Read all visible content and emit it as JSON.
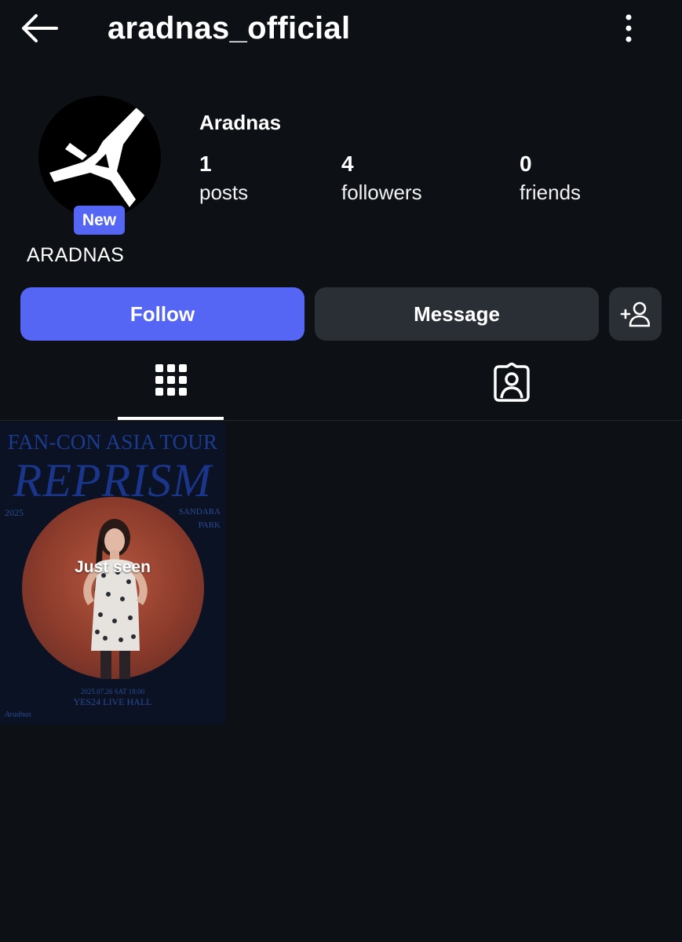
{
  "header": {
    "username": "aradnas_official",
    "back_icon": "arrow-left-icon",
    "more_icon": "more-vertical-icon"
  },
  "profile": {
    "display_name": "Aradnas",
    "badge": "New",
    "nickname": "ARADNAS",
    "avatar_icon": "aradnas-logo",
    "stats": {
      "posts": {
        "value": "1",
        "label": "posts"
      },
      "followers": {
        "value": "4",
        "label": "followers"
      },
      "friends": {
        "value": "0",
        "label": "friends"
      }
    }
  },
  "actions": {
    "follow_label": "Follow",
    "message_label": "Message",
    "add_friend_icon": "add-user-icon"
  },
  "tabs": [
    {
      "name": "posts-grid",
      "icon": "grid-icon",
      "active": true
    },
    {
      "name": "tagged",
      "icon": "tagged-user-icon",
      "active": false
    }
  ],
  "posts": [
    {
      "overlay": "Just seen",
      "poster": {
        "title": "FAN-CON ASIA TOUR",
        "headline": "REPRISM",
        "year": "2025",
        "artist_line1": "SANDARA",
        "artist_line2": "PARK",
        "date": "2025.07.26 SAT 18:00",
        "venue": "YES24 LIVE HALL",
        "brand": "Aradnas"
      }
    }
  ],
  "colors": {
    "background": "#0d1015",
    "accent": "#5566f5",
    "secondary_button": "#2a2e35"
  }
}
